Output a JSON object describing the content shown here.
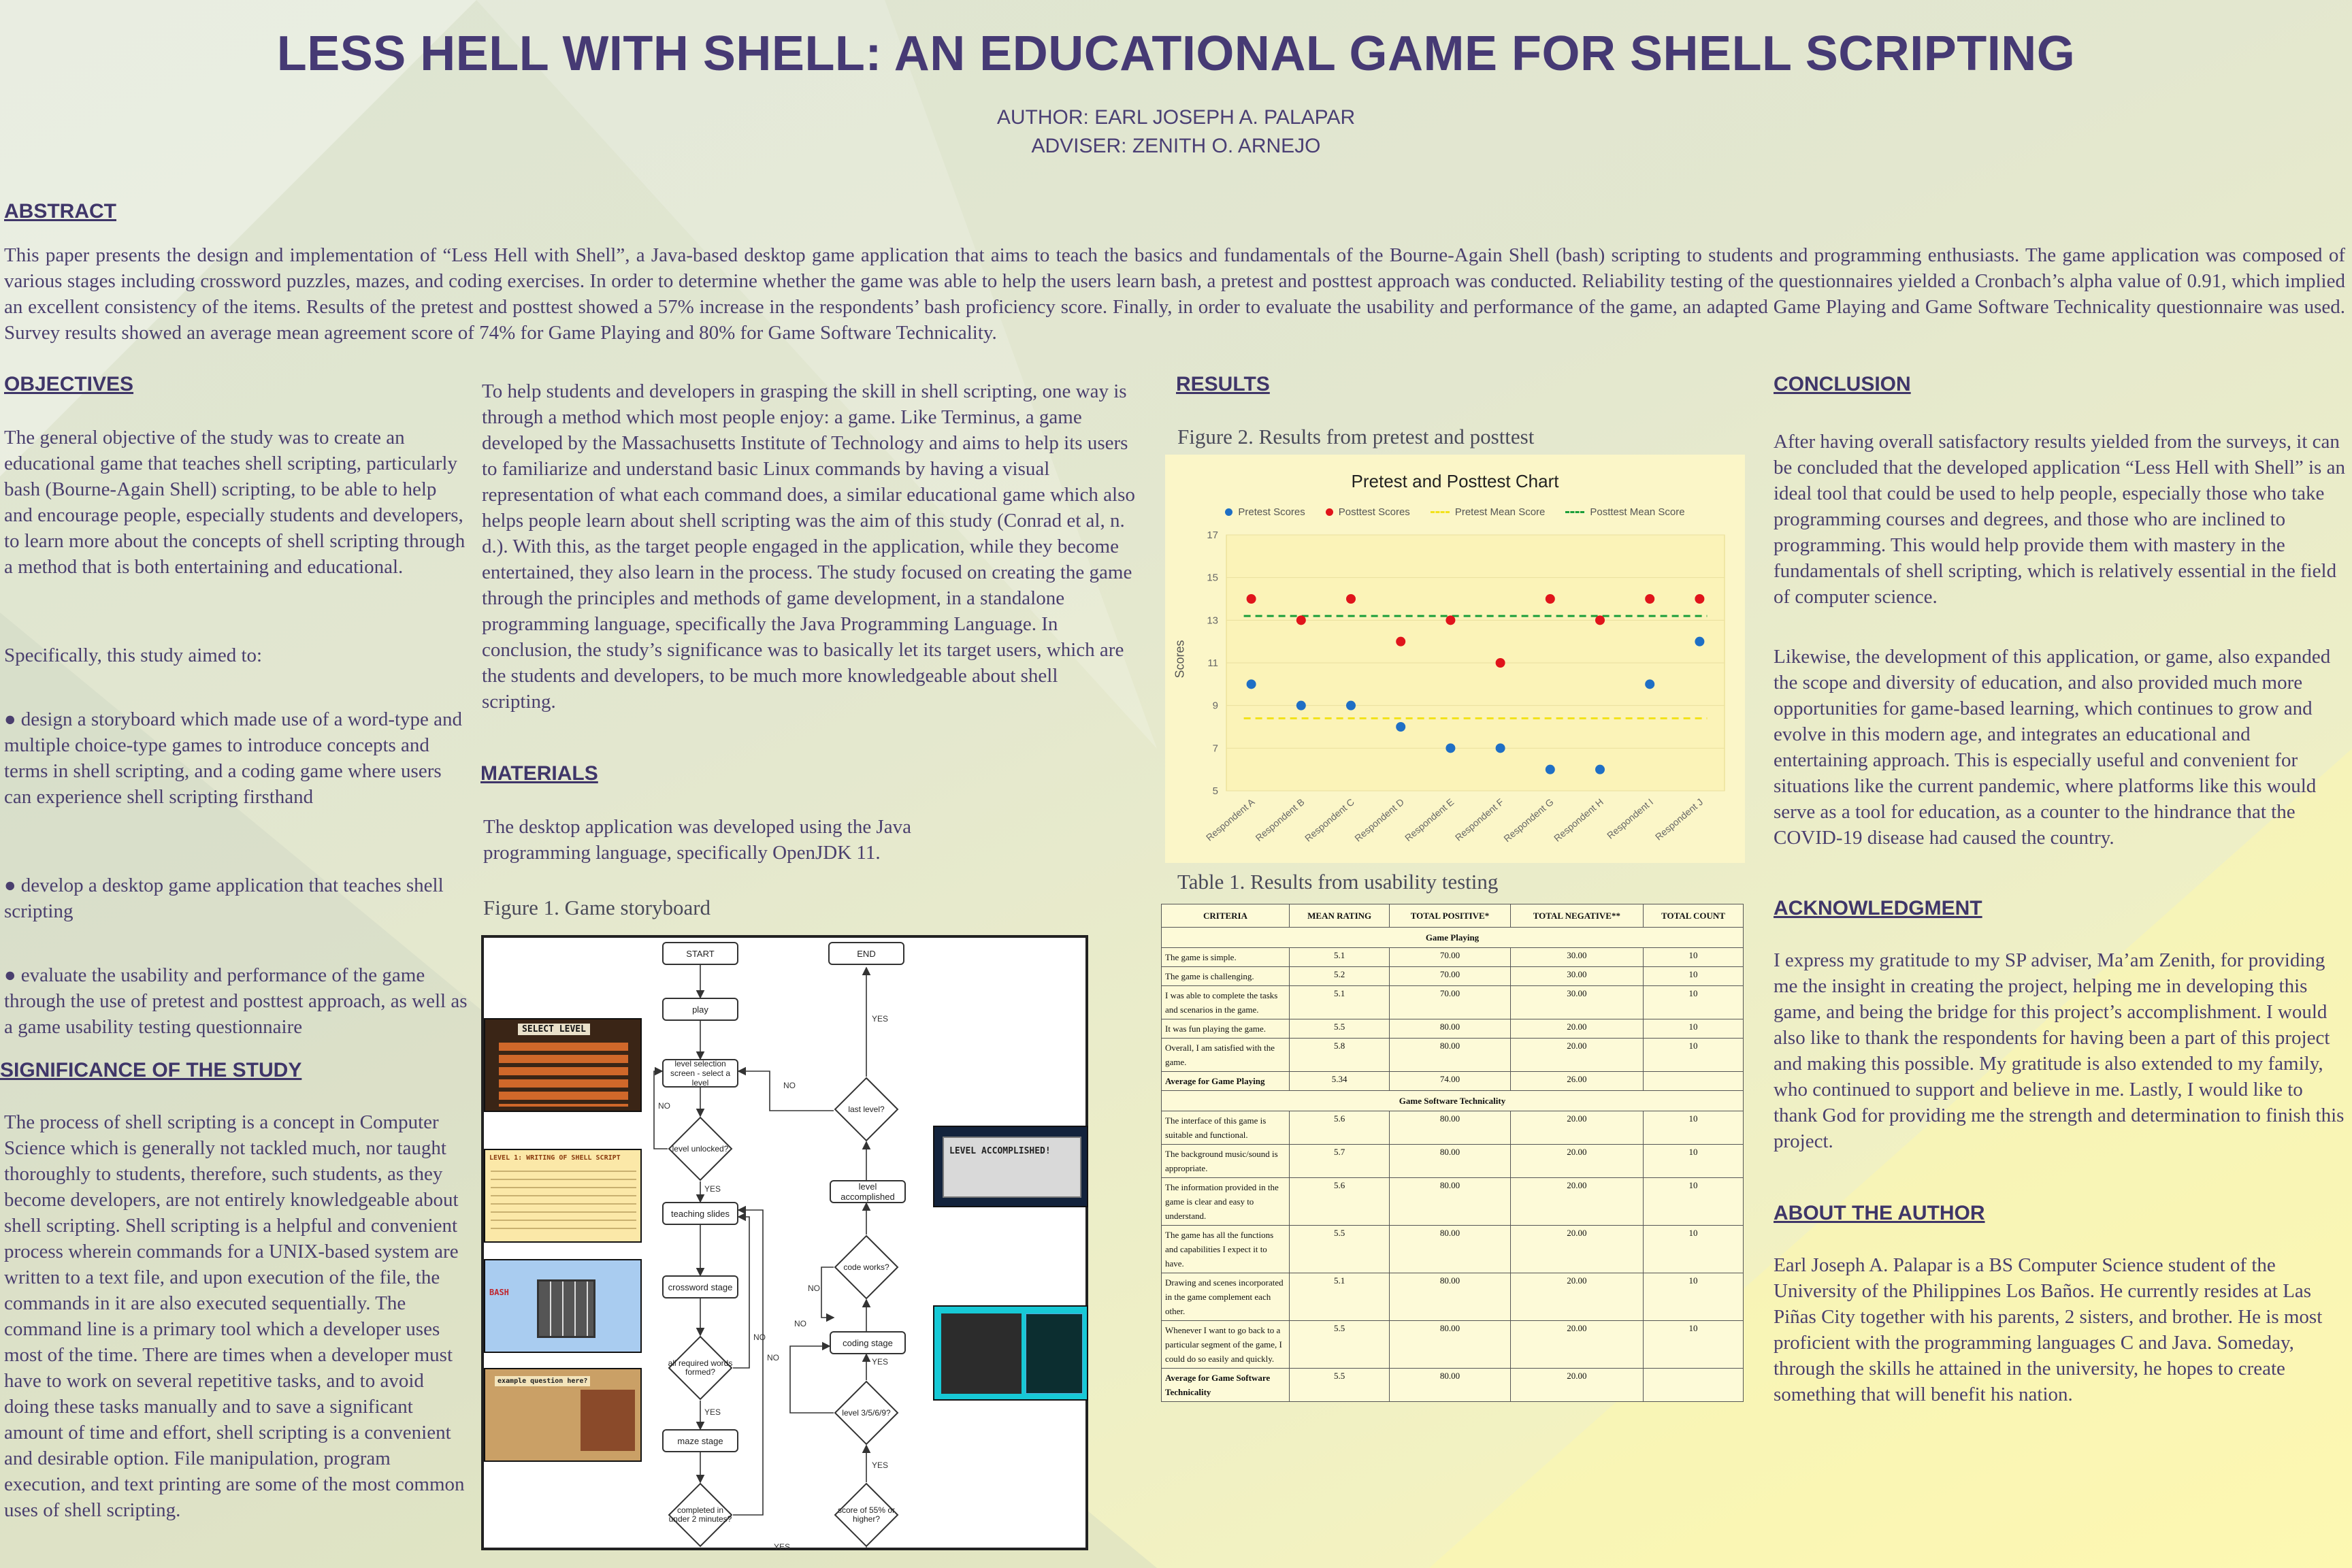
{
  "title": "LESS HELL WITH SHELL: AN EDUCATIONAL GAME FOR SHELL SCRIPTING",
  "author": "AUTHOR: EARL JOSEPH A. PALAPAR",
  "adviser": "ADVISER: ZENITH O. ARNEJO",
  "abstract": {
    "heading": "ABSTRACT",
    "text": "This paper presents the design and implementation of “Less Hell with Shell”, a Java-based desktop game application that aims to teach the basics and fundamentals of the Bourne-Again Shell (bash) scripting to students and programming enthusiasts. The game application was composed of various stages including crossword puzzles, mazes, and coding exercises. In order to determine whether the game was able to help the users learn bash, a pretest and posttest approach was conducted. Reliability testing of the questionnaires yielded a Cronbach’s alpha value of 0.91, which implied an excellent consistency of the items. Results of the pretest and posttest showed a 57% increase in the respondents’ bash proficiency score. Finally, in order to evaluate the usability and performance of the game, an adapted Game Playing and Game Software Technicality questionnaire was used. Survey results showed an average mean agreement score of 74% for Game Playing and 80% for Game Software Technicality."
  },
  "objectives": {
    "heading": "OBJECTIVES",
    "p1": "The general objective of the study was to create an educational game that teaches shell scripting, particularly bash (Bourne-Again Shell) scripting, to be able to help and encourage people, especially students and developers, to learn more about the concepts of shell scripting through a method that is both entertaining and educational.",
    "p2": "Specifically, this study aimed to:",
    "items": [
      "● design a storyboard which made use of a word-type and multiple choice-type games to introduce concepts and terms in shell scripting, and a coding game where users can experience shell scripting firsthand",
      "● develop a desktop game application that teaches shell scripting",
      "● evaluate the usability and performance of the game through the use of pretest and posttest approach, as well as a game usability testing questionnaire"
    ]
  },
  "significance": {
    "heading": "SIGNIFICANCE OF THE STUDY",
    "p1": "The process of shell scripting is a concept in Computer Science which is generally not tackled much, nor taught thoroughly to students, therefore, such students, as they become developers, are not entirely knowledgeable about shell scripting. Shell scripting is a helpful and convenient process wherein commands for a UNIX-based system are written to a text file, and upon execution of the file, the commands in it are also executed sequentially. The command line is a primary tool which a developer uses most of the time. There are times when a developer must have to work on several repetitive tasks, and to avoid doing these tasks manually and to save a significant amount of time and effort, shell scripting is a convenient and desirable option. File manipulation, program execution, and text printing are some of the most common uses of shell scripting.",
    "p2": "To help students and developers in grasping the skill in shell scripting, one way is through a method which most people enjoy: a game. Like Terminus, a game developed by the Massachusetts Institute of Technology and aims to help its users to familiarize and understand basic Linux commands by having a visual representation of what each command does, a similar educational game which also helps people learn about shell scripting was the aim of this study (Conrad et al, n. d.). With this, as the target people engaged in the application, while they become entertained, they also learn in the process. The study focused on creating the game through the principles and methods of game development, in a standalone programming language, specifically the Java Programming Language. In conclusion, the study’s significance was to basically let its target users, which are the students and developers, to be much more knowledgeable about shell scripting."
  },
  "materials": {
    "heading": "MATERIALS",
    "text": "The desktop application was developed using the Java programming language, specifically OpenJDK 11.",
    "fig_caption": "Figure 1. Game storyboard"
  },
  "flowchart": {
    "start": "START",
    "end": "END",
    "play": "play",
    "level_select": "level selection screen - select a level",
    "unlocked": "level unlocked?",
    "teaching": "teaching slides",
    "crossword": "crossword stage",
    "all_words": "all required words formed?",
    "maze": "maze stage",
    "under2": "completed in under 2 minutes?",
    "score": "score of 55% or higher?",
    "level3569": "level 3/5/6/9?",
    "coding": "coding stage",
    "code_works": "code works?",
    "accomplished": "level accomplished",
    "last_level": "last level?",
    "yes": "YES",
    "no": "NO",
    "shot_select": "SELECT LEVEL",
    "shot_accomplished": "LEVEL ACCOMPLISHED!",
    "shot_writing": "LEVEL 1: WRITING OF SHELL SCRIPT",
    "shot_basic": "BASH",
    "shot_question": "example question here?"
  },
  "results": {
    "heading": "RESULTS",
    "fig_caption": "Figure 2. Results from pretest and posttest",
    "table_caption": "Table 1. Results from usability testing"
  },
  "chart_data": {
    "type": "scatter",
    "title": "Pretest and Posttest Chart",
    "ylabel": "Scores",
    "xlabel": "",
    "ylim": [
      5,
      17
    ],
    "yticks": [
      5,
      7,
      9,
      11,
      13,
      15,
      17
    ],
    "categories": [
      "Respondent A",
      "Respondent B",
      "Respondent C",
      "Respondent D",
      "Respondent E",
      "Respondent F",
      "Respondent G",
      "Respondent H",
      "Respondent I",
      "Respondent J"
    ],
    "series": [
      {
        "name": "Pretest Scores",
        "values": [
          10,
          9,
          9,
          8,
          7,
          7,
          6,
          6,
          10,
          12
        ],
        "color": "#1f6fc5"
      },
      {
        "name": "Posttest Scores",
        "values": [
          14,
          13,
          14,
          12,
          13,
          11,
          14,
          13,
          14,
          14
        ],
        "color": "#e0141b"
      },
      {
        "name": "Pretest Mean Score",
        "values": [
          8.4,
          8.4,
          8.4,
          8.4,
          8.4,
          8.4,
          8.4,
          8.4,
          8.4,
          8.4
        ],
        "color": "#f2e21c"
      },
      {
        "name": "Posttest Mean Score",
        "values": [
          13.2,
          13.2,
          13.2,
          13.2,
          13.2,
          13.2,
          13.2,
          13.2,
          13.2,
          13.2
        ],
        "color": "#1a9e3a"
      }
    ],
    "legend": "top"
  },
  "table": {
    "headers": [
      "CRITERIA",
      "MEAN RATING",
      "TOTAL POSITIVE*",
      "TOTAL NEGATIVE**",
      "TOTAL COUNT"
    ],
    "group1": "Game Playing",
    "rows1": [
      {
        "c": "The game is simple.",
        "m": "5.1",
        "p": "70.00",
        "n": "30.00",
        "t": "10"
      },
      {
        "c": "The game is challenging.",
        "m": "5.2",
        "p": "70.00",
        "n": "30.00",
        "t": "10"
      },
      {
        "c": "I was able to complete the tasks and scenarios in the game.",
        "m": "5.1",
        "p": "70.00",
        "n": "30.00",
        "t": "10"
      },
      {
        "c": "It was fun playing the game.",
        "m": "5.5",
        "p": "80.00",
        "n": "20.00",
        "t": "10"
      },
      {
        "c": "Overall, I am satisfied with the game.",
        "m": "5.8",
        "p": "80.00",
        "n": "20.00",
        "t": "10"
      },
      {
        "c": "Average for Game Playing",
        "m": "5.34",
        "p": "74.00",
        "n": "26.00",
        "t": ""
      }
    ],
    "group2": "Game Software Technicality",
    "rows2": [
      {
        "c": "The interface of this game is suitable and functional.",
        "m": "5.6",
        "p": "80.00",
        "n": "20.00",
        "t": "10"
      },
      {
        "c": "The background music/sound is appropriate.",
        "m": "5.7",
        "p": "80.00",
        "n": "20.00",
        "t": "10"
      },
      {
        "c": "The information provided in the game is clear and easy to understand.",
        "m": "5.6",
        "p": "80.00",
        "n": "20.00",
        "t": "10"
      },
      {
        "c": "The game has all the functions and capabilities I expect it to have.",
        "m": "5.5",
        "p": "80.00",
        "n": "20.00",
        "t": "10"
      },
      {
        "c": "Drawing and scenes incorporated in the game complement each other.",
        "m": "5.1",
        "p": "80.00",
        "n": "20.00",
        "t": "10"
      },
      {
        "c": "Whenever I want to go back to a particular segment of the game, I could do so easily and quickly.",
        "m": "5.5",
        "p": "80.00",
        "n": "20.00",
        "t": "10"
      },
      {
        "c": "Average for Game Software Technicality",
        "m": "5.5",
        "p": "80.00",
        "n": "20.00",
        "t": ""
      }
    ]
  },
  "conclusion": {
    "heading": "CONCLUSION",
    "p1": "After having overall satisfactory results yielded from the surveys, it can be concluded that the developed application “Less Hell with Shell” is an ideal tool that could be used to help people, especially those who take programming courses and degrees, and those who are inclined to programming. This would help provide them with mastery in the fundamentals of shell scripting, which is relatively essential in the field of computer science.",
    "p2": "Likewise, the development of this application, or game, also expanded the scope and diversity of education, and also provided much more opportunities for game-based learning, which continues to grow and evolve in this modern age, and integrates an educational and entertaining approach. This is especially useful and convenient for situations like the current pandemic, where platforms like this would serve as a tool for education, as a counter to the hindrance that the COVID-19 disease had caused the country."
  },
  "acknowledgment": {
    "heading": "ACKNOWLEDGMENT",
    "text": "I express my gratitude to my SP adviser, Ma’am Zenith, for providing me the insight in creating the project, helping me in developing this game, and being the bridge for this project’s accomplishment. I would also like to thank the respondents for having been a part of this project and making this possible. My gratitude is also extended to my family, who continued to support and believe in me. Lastly, I would like to thank God for providing me the strength and determination to finish this project."
  },
  "about": {
    "heading": "ABOUT THE AUTHOR",
    "text": "Earl Joseph A. Palapar is a BS Computer Science student of the University of the Philippines Los Baños. He currently resides at Las Piñas City together with his parents, 2 sisters, and brother. He is most proficient with the programming languages C and Java. Someday, through the skills he attained in the university, he hopes to create something that will benefit his nation."
  }
}
